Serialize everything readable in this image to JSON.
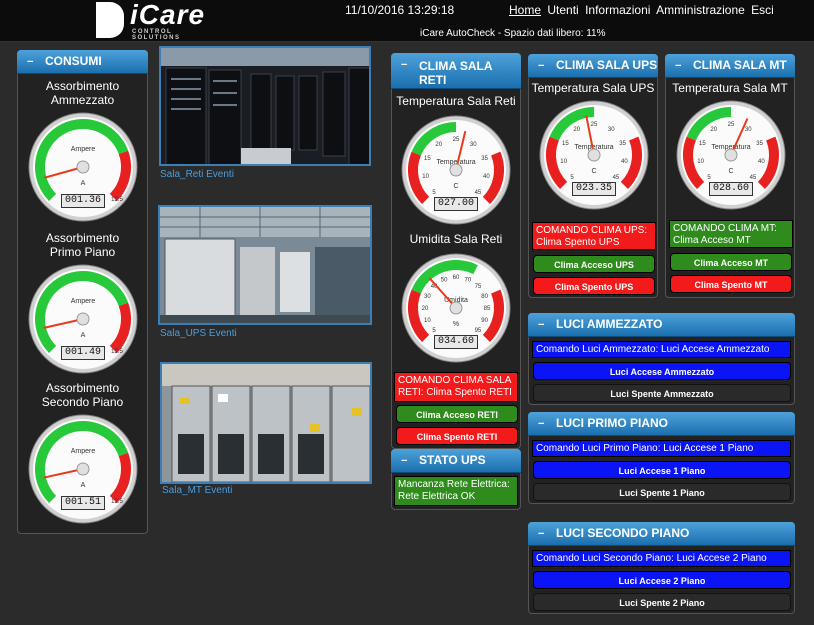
{
  "header": {
    "logo_text": "iCare",
    "logo_sub": "CONTROL SOLUTIONS",
    "datetime": "11/10/2016 13:29:18",
    "nav": [
      "Home",
      "Utenti",
      "Informazioni",
      "Amministrazione",
      "Esci"
    ],
    "status": "iCare AutoCheck - Spazio dati libero: 11%"
  },
  "consumi": {
    "title": "CONSUMI",
    "gauges": [
      {
        "label": "Assorbimento Ammezzato",
        "unit_title": "Ampere",
        "unit": "A",
        "value": 1.36,
        "display": "001.36",
        "max": 12.5
      },
      {
        "label": "Assorbimento Primo Piano",
        "unit_title": "Ampere",
        "unit": "A",
        "value": 1.49,
        "display": "001.49",
        "max": 12.5
      },
      {
        "label": "Assorbimento Secondo Piano",
        "unit_title": "Ampere",
        "unit": "A",
        "value": 1.51,
        "display": "001.51",
        "max": 12.5
      }
    ]
  },
  "photos": [
    {
      "link": "Sala_Reti Eventi"
    },
    {
      "link": "Sala_UPS Eventi"
    },
    {
      "link": "Sala_MT Eventi"
    }
  ],
  "clima_reti": {
    "title": "CLIMA SALA RETI",
    "temp_label": "Temperatura Sala Reti",
    "temp_gauge": {
      "unit_title": "Temperatura",
      "unit": "C",
      "value": 27.0,
      "display": "027.00",
      "ticks": [
        "5",
        "10",
        "15",
        "20",
        "25",
        "30",
        "35",
        "40",
        "45"
      ]
    },
    "hum_label": "Umidita Sala Reti",
    "hum_gauge": {
      "unit_title": "Umidita",
      "unit": "%",
      "value": 34.6,
      "display": "034.60",
      "ticks": [
        "5",
        "10",
        "20",
        "30",
        "40",
        "50",
        "60",
        "70",
        "75",
        "80",
        "85",
        "90",
        "95"
      ]
    },
    "status_msg": "COMANDO CLIMA SALA RETI: Clima Spento RETI",
    "btn_on": "Clima Acceso RETI",
    "btn_off": "Clima Spento RETI"
  },
  "clima_ups": {
    "title": "CLIMA SALA UPS",
    "temp_label": "Temperatura Sala UPS",
    "gauge": {
      "unit_title": "Temperatura",
      "unit": "C",
      "value": 23.35,
      "display": "023.35",
      "ticks": [
        "5",
        "10",
        "15",
        "20",
        "25",
        "30",
        "35",
        "40",
        "45"
      ]
    },
    "status_msg": "COMANDO CLIMA UPS: Clima Spento UPS",
    "btn_on": "Clima Acceso UPS",
    "btn_off": "Clima Spento UPS"
  },
  "clima_mt": {
    "title": "CLIMA SALA MT",
    "temp_label": "Temperatura Sala MT",
    "gauge": {
      "unit_title": "Temperatura",
      "unit": "C",
      "value": 28.6,
      "display": "028.60",
      "ticks": [
        "5",
        "10",
        "15",
        "20",
        "25",
        "30",
        "35",
        "40",
        "45"
      ]
    },
    "status_msg": "COMANDO CLIMA MT: Clima Acceso MT",
    "btn_on": "Clima Acceso MT",
    "btn_off": "Clima Spento MT"
  },
  "stato_ups": {
    "title": "STATO UPS",
    "msg": "Mancanza Rete Elettrica: Rete Elettrica OK"
  },
  "luci_ammezzato": {
    "title": "LUCI AMMEZZATO",
    "msg": "Comando Luci Ammezzato: Luci Accese Ammezzato",
    "btn_on": "Luci Accese Ammezzato",
    "btn_off": "Luci Spente Ammezzato"
  },
  "luci_primo": {
    "title": "LUCI PRIMO PIANO",
    "msg": "Comando Luci Primo Piano: Luci Accese 1 Piano",
    "btn_on": "Luci Accese 1 Piano",
    "btn_off": "Luci Spente 1 Piano"
  },
  "luci_secondo": {
    "title": "LUCI SECONDO PIANO",
    "msg": "Comando Luci Secondo Piano: Luci Accese 2 Piano",
    "btn_on": "Luci Accese 2 Piano",
    "btn_off": "Luci Spente 2 Piano"
  },
  "colors": {
    "accent": "#1a6fae",
    "green": "#2e8b1c",
    "red": "#f21a1a",
    "blue": "#0a14f5"
  },
  "icons": {
    "minimize": "minus-icon",
    "logo": "icare-logo"
  }
}
